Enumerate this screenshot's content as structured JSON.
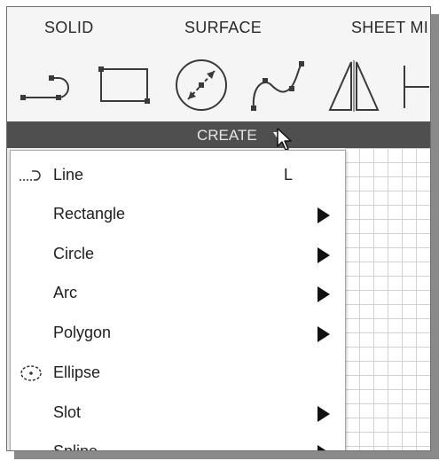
{
  "tabs": {
    "solid": "SOLID",
    "surface": "SURFACE",
    "sheet": "SHEET MI"
  },
  "toolbar": {
    "tools": [
      {
        "name": "line-tool",
        "icon": "line-arc-icon"
      },
      {
        "name": "rectangle-tool",
        "icon": "rectangle-icon"
      },
      {
        "name": "circle-tool",
        "icon": "circle-diameter-icon"
      },
      {
        "name": "spline-tool",
        "icon": "spline-icon"
      },
      {
        "name": "mirror-tool",
        "icon": "mirror-icon"
      },
      {
        "name": "dimension-tool",
        "icon": "dimension-icon"
      }
    ]
  },
  "create": {
    "label": "CREATE"
  },
  "menu": {
    "items": [
      {
        "label": "Line",
        "shortcut": "L",
        "icon": "line-arc-icon",
        "submenu": false
      },
      {
        "label": "Rectangle",
        "submenu": true
      },
      {
        "label": "Circle",
        "submenu": true
      },
      {
        "label": "Arc",
        "submenu": true
      },
      {
        "label": "Polygon",
        "submenu": true
      },
      {
        "label": "Ellipse",
        "icon": "ellipse-icon",
        "submenu": false
      },
      {
        "label": "Slot",
        "submenu": true
      },
      {
        "label": "Spline",
        "submenu": true
      }
    ]
  },
  "colors": {
    "create_bar": "#4f4f4f",
    "menu_bg": "#ffffff",
    "grid_line": "#d2d2d2"
  }
}
